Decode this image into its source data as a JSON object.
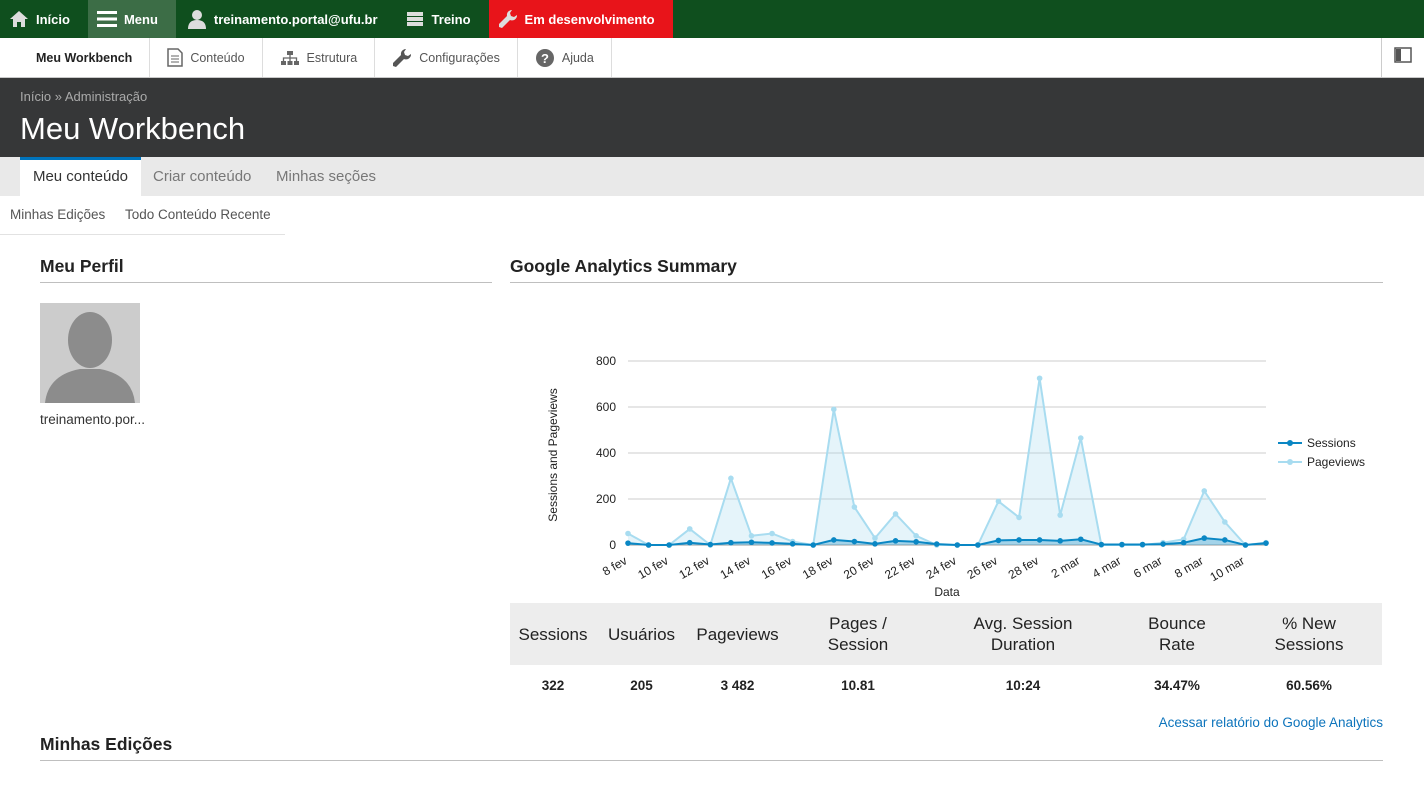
{
  "toolbar": {
    "home": "Início",
    "menu": "Menu",
    "user": "treinamento.portal@ufu.br",
    "treino": "Treino",
    "dev": "Em desenvolvimento",
    "colors": {
      "bar": "#0f4f1e",
      "active": "#3c6d46",
      "dev": "#e8141a"
    }
  },
  "tray": {
    "workbench": "Meu Workbench",
    "content": "Conteúdo",
    "structure": "Estrutura",
    "config": "Configurações",
    "help": "Ajuda"
  },
  "header": {
    "breadcrumb_home": "Início",
    "breadcrumb_sep": "»",
    "breadcrumb_admin": "Administração",
    "title": "Meu Workbench"
  },
  "tabs": [
    "Meu conteúdo",
    "Criar conteúdo",
    "Minhas seções"
  ],
  "subtabs": [
    "Minhas Edições",
    "Todo Conteúdo Recente"
  ],
  "profile": {
    "title": "Meu Perfil",
    "username": "treinamento.por..."
  },
  "analytics": {
    "title": "Google Analytics Summary",
    "headers": [
      "Sessions",
      "Usuários",
      "Pageviews",
      "Pages / Session",
      "Avg. Session Duration",
      "Bounce Rate",
      "% New Sessions"
    ],
    "values": [
      "322",
      "205",
      "3 482",
      "10.81",
      "10:24",
      "34.47%",
      "60.56%"
    ],
    "link": "Acessar relatório do Google Analytics"
  },
  "edits": {
    "title": "Minhas Edições"
  },
  "chart_data": {
    "type": "area",
    "xlabel": "Data",
    "ylabel": "Sessions and Pageviews",
    "ylim": [
      0,
      800
    ],
    "yticks": [
      0,
      200,
      400,
      600,
      800
    ],
    "xtick_labels": [
      "8 fev",
      "10 fev",
      "12 fev",
      "14 fev",
      "16 fev",
      "18 fev",
      "20 fev",
      "22 fev",
      "24 fev",
      "26 fev",
      "28 fev",
      "2 mar",
      "4 mar",
      "6 mar",
      "8 mar",
      "10 mar"
    ],
    "x": [
      "8 fev",
      "9 fev",
      "10 fev",
      "11 fev",
      "12 fev",
      "13 fev",
      "14 fev",
      "15 fev",
      "16 fev",
      "17 fev",
      "18 fev",
      "19 fev",
      "20 fev",
      "21 fev",
      "22 fev",
      "23 fev",
      "24 fev",
      "25 fev",
      "26 fev",
      "27 fev",
      "28 fev",
      "1 mar",
      "2 mar",
      "3 mar",
      "4 mar",
      "5 mar",
      "6 mar",
      "7 mar",
      "8 mar",
      "9 mar",
      "10 mar",
      "11 mar"
    ],
    "legend_position": "right",
    "series": [
      {
        "name": "Sessions",
        "color": "#0a87c4",
        "values": [
          8,
          0,
          0,
          10,
          2,
          10,
          12,
          9,
          5,
          0,
          22,
          15,
          5,
          18,
          14,
          4,
          0,
          0,
          20,
          22,
          22,
          18,
          25,
          2,
          2,
          2,
          4,
          10,
          30,
          22,
          0,
          8
        ]
      },
      {
        "name": "Pageviews",
        "color": "#a8dcf0",
        "values": [
          50,
          0,
          0,
          70,
          0,
          290,
          40,
          50,
          15,
          0,
          590,
          165,
          30,
          135,
          40,
          0,
          0,
          0,
          190,
          120,
          725,
          130,
          465,
          0,
          0,
          0,
          10,
          25,
          235,
          100,
          0,
          10
        ]
      }
    ]
  }
}
